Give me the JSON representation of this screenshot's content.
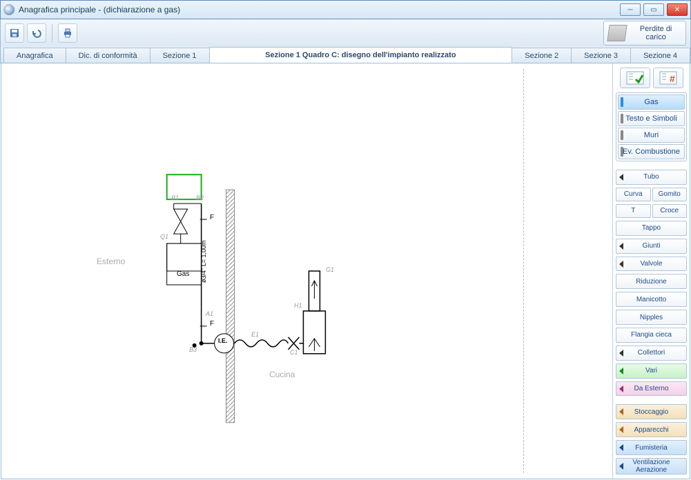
{
  "window": {
    "title": "Anagrafica principale - (dichiarazione a gas)"
  },
  "toolbar": {
    "perdite_label": "Perdite di carico"
  },
  "tabs": {
    "anagrafica": "Anagrafica",
    "dic_conformita": "Dic. di conformità",
    "sezione1": "Sezione 1",
    "sezione1_quadroC": "Sezione 1 Quadro C: disegno dell'impianto realizzato",
    "sezione2": "Sezione 2",
    "sezione3": "Sezione 3",
    "sezione4": "Sezione 4"
  },
  "drawing": {
    "esterno": "Esterno",
    "cucina": "Cucina",
    "gas_box": "Gas",
    "ie": "I.E.",
    "b1": "B1",
    "b2": "B2",
    "b3": "B3",
    "q1": "Q1",
    "a1": "A1",
    "e1": "E1",
    "c1": "C1",
    "g1": "G1",
    "h1": "H1",
    "f": "F",
    "pipe_spec": "ø3/4\" L= 1,00m"
  },
  "palette": {
    "categories": {
      "gas": "Gas",
      "testo": "Testo e Simboli",
      "muri": "Muri",
      "ev_comb": "Ev. Combustione"
    },
    "items": {
      "tubo": "Tubo",
      "curva": "Curva",
      "gomito": "Gomito",
      "t": "T",
      "croce": "Croce",
      "tappo": "Tappo",
      "giunti": "Giunti",
      "valvole": "Valvole",
      "riduzione": "Riduzione",
      "manicotto": "Manicotto",
      "nipples": "Nipples",
      "flangia": "Flangia cieca",
      "collettori": "Collettori",
      "vari": "Vari",
      "da_esterno": "Da Esterno",
      "stoccaggio": "Stoccaggio",
      "apparecchi": "Apparecchi",
      "fumisteria": "Fumisteria",
      "ventilazione": "Ventilazione Aerazione"
    }
  }
}
